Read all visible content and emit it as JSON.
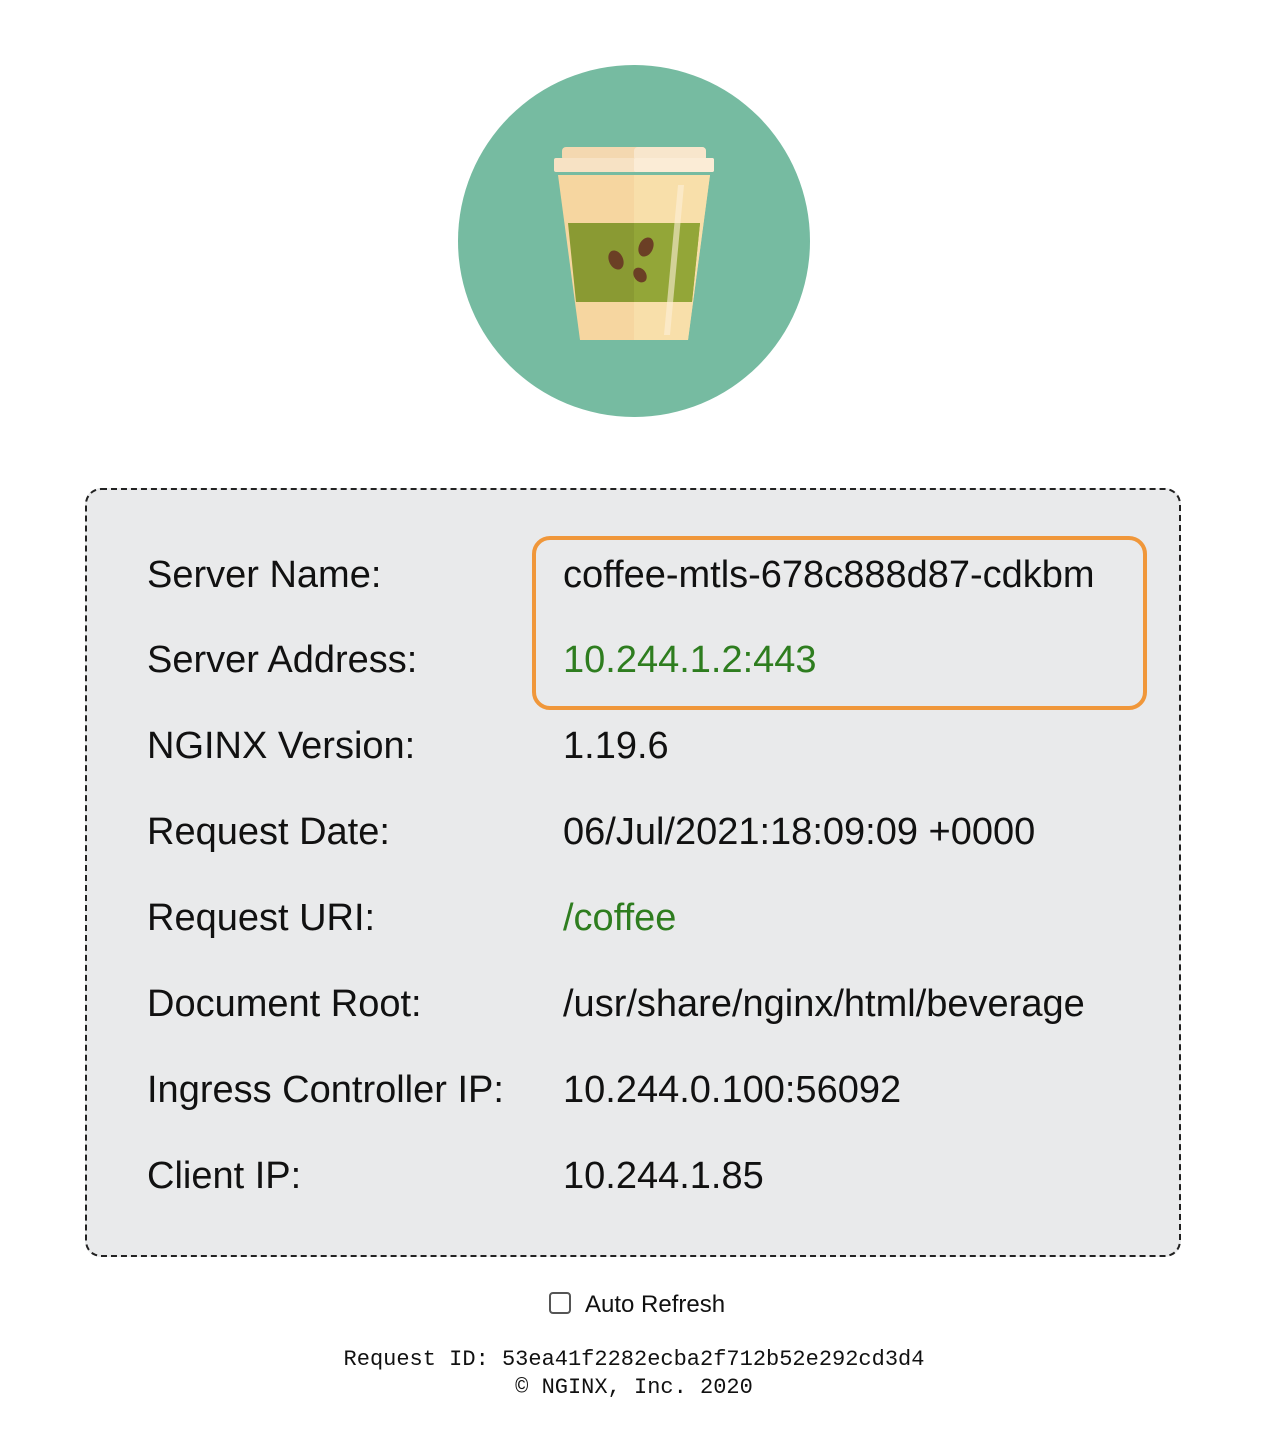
{
  "logo": {
    "icon": "coffee-cup-icon",
    "circle_color": "#76bba1"
  },
  "info": {
    "rows": [
      {
        "label": "Server Name:",
        "value": "coffee-mtls-678c888d87-cdkbm"
      },
      {
        "label": "Server Address:",
        "value": "10.244.1.2:443"
      },
      {
        "label": "NGINX Version:",
        "value": "1.19.6"
      },
      {
        "label": "Request Date:",
        "value": "06/Jul/2021:18:09:09 +0000"
      },
      {
        "label": "Request URI:",
        "value": "/coffee"
      },
      {
        "label": "Document Root:",
        "value": "/usr/share/nginx/html/beverage"
      },
      {
        "label": "Ingress Controller IP:",
        "value": "10.244.0.100:56092"
      },
      {
        "label": "Client IP:",
        "value": "10.244.1.85"
      }
    ],
    "highlight_color": "#f0973a",
    "green_value_color": "#2e7d1f"
  },
  "auto_refresh": {
    "label": "Auto Refresh",
    "checked": false
  },
  "footer": {
    "request_id": "Request ID: 53ea41f2282ecba2f712b52e292cd3d4",
    "copyright": "© NGINX, Inc. 2020"
  }
}
